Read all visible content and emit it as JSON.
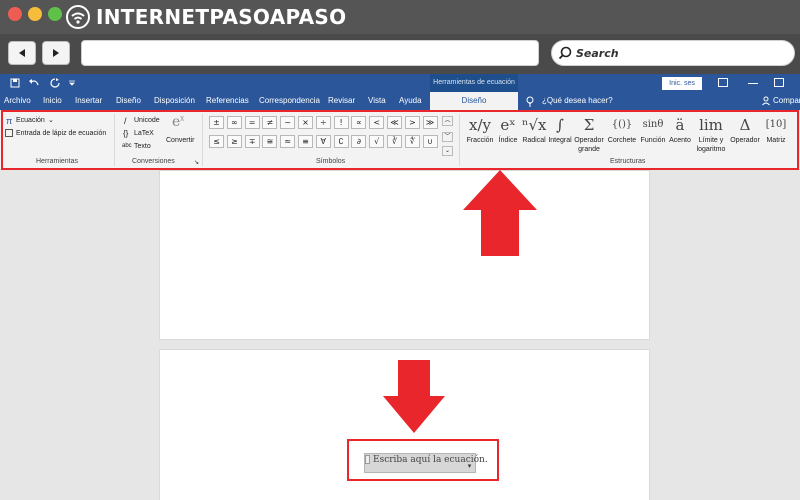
{
  "brand": {
    "name": "INTERNETPASOAPASO"
  },
  "browser": {
    "search_label": "Search"
  },
  "word": {
    "context_title": "Herramientas de ecuación",
    "sign_in": "Inic. ses",
    "tabs": [
      "Archivo",
      "Inicio",
      "Insertar",
      "Diseño",
      "Disposición",
      "Referencias",
      "Correspondencia",
      "Revisar",
      "Vista",
      "Ayuda",
      "Diseño"
    ],
    "tell_me": "¿Qué desea hacer?",
    "share": "Compar"
  },
  "ribbon": {
    "herramientas": {
      "label": "Herramientas",
      "equation": "Ecuación",
      "ink_equation": "Entrada de lápiz de ecuación"
    },
    "conversiones": {
      "label": "Conversiones",
      "unicode": "Unicode",
      "latex": "LaTeX",
      "text": "Texto",
      "convert": "Convertir"
    },
    "simbolos": {
      "label": "Símbolos",
      "row1": [
        "±",
        "∞",
        "=",
        "≠",
        "~",
        "×",
        "÷",
        "!",
        "∝",
        "<",
        "≪",
        ">",
        "≫"
      ],
      "row2": [
        "≤",
        "≥",
        "∓",
        "≅",
        "≈",
        "≡",
        "∀",
        "∁",
        "∂",
        "√",
        "∛",
        "∜",
        "∪"
      ]
    },
    "estructuras": {
      "label": "Estructuras",
      "items": [
        {
          "glyph": "x/y",
          "label": "Fracción"
        },
        {
          "glyph": "eˣ",
          "label": "Índice"
        },
        {
          "glyph": "ⁿ√x",
          "label": "Radical"
        },
        {
          "glyph": "∫",
          "label": "Integral"
        },
        {
          "glyph": "Σ",
          "label": "Operador grande"
        },
        {
          "glyph": "{()}",
          "label": "Corchete"
        },
        {
          "glyph": "sinθ",
          "label": "Función"
        },
        {
          "glyph": "ä",
          "label": "Acento"
        },
        {
          "glyph": "lim",
          "label": "Límite y logaritmo"
        },
        {
          "glyph": "Δ",
          "label": "Operador"
        },
        {
          "glyph": "[10]",
          "label": "Matriz"
        }
      ]
    }
  },
  "document": {
    "equation_placeholder": "Escriba aquí la ecuación."
  },
  "colors": {
    "word_blue": "#2b579a",
    "highlight_red": "#e8262c"
  }
}
